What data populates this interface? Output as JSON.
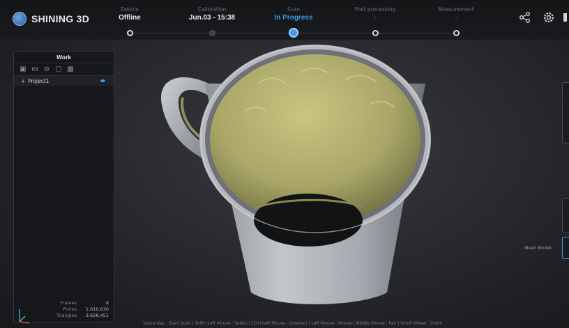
{
  "app": {
    "brand": "SHINING 3D"
  },
  "workflow": [
    {
      "label": "Device",
      "value": "Offline",
      "state": "done"
    },
    {
      "label": "Calibration",
      "value": "Jun.03 - 15:38",
      "state": "done"
    },
    {
      "label": "Scan",
      "value": "In Progress",
      "state": "active"
    },
    {
      "label": "Post processing",
      "value": "-",
      "state": "pending"
    },
    {
      "label": "Measurement",
      "value": "-",
      "state": "pending"
    }
  ],
  "top_icons": [
    "share-icon",
    "settings-icon",
    "help-icon"
  ],
  "panel": {
    "title": "Work",
    "tools": [
      "new-icon",
      "open-icon",
      "remove-icon",
      "save-icon",
      "grid-icon"
    ],
    "tree": [
      {
        "label": "Project1",
        "expand": "+"
      }
    ],
    "stats": [
      {
        "key": "Frames",
        "value": "8"
      },
      {
        "key": "Points",
        "value": "1,610,630"
      },
      {
        "key": "Triangles",
        "value": "3,628,451"
      }
    ]
  },
  "right": {
    "mesh_label": "Mesh Model"
  },
  "statusbar": "Space Key : Start Scan | Shift+Left Mouse : Select | Ctrl+Left Mouse : Unselect | Left Mouse : Rotate | Middle Mouse : Pan | Scroll Wheel : Zoom",
  "colors": {
    "accent": "#3d9be9",
    "scan_surface": "#b9b77a",
    "mesh_gray": "#a9adb3"
  }
}
